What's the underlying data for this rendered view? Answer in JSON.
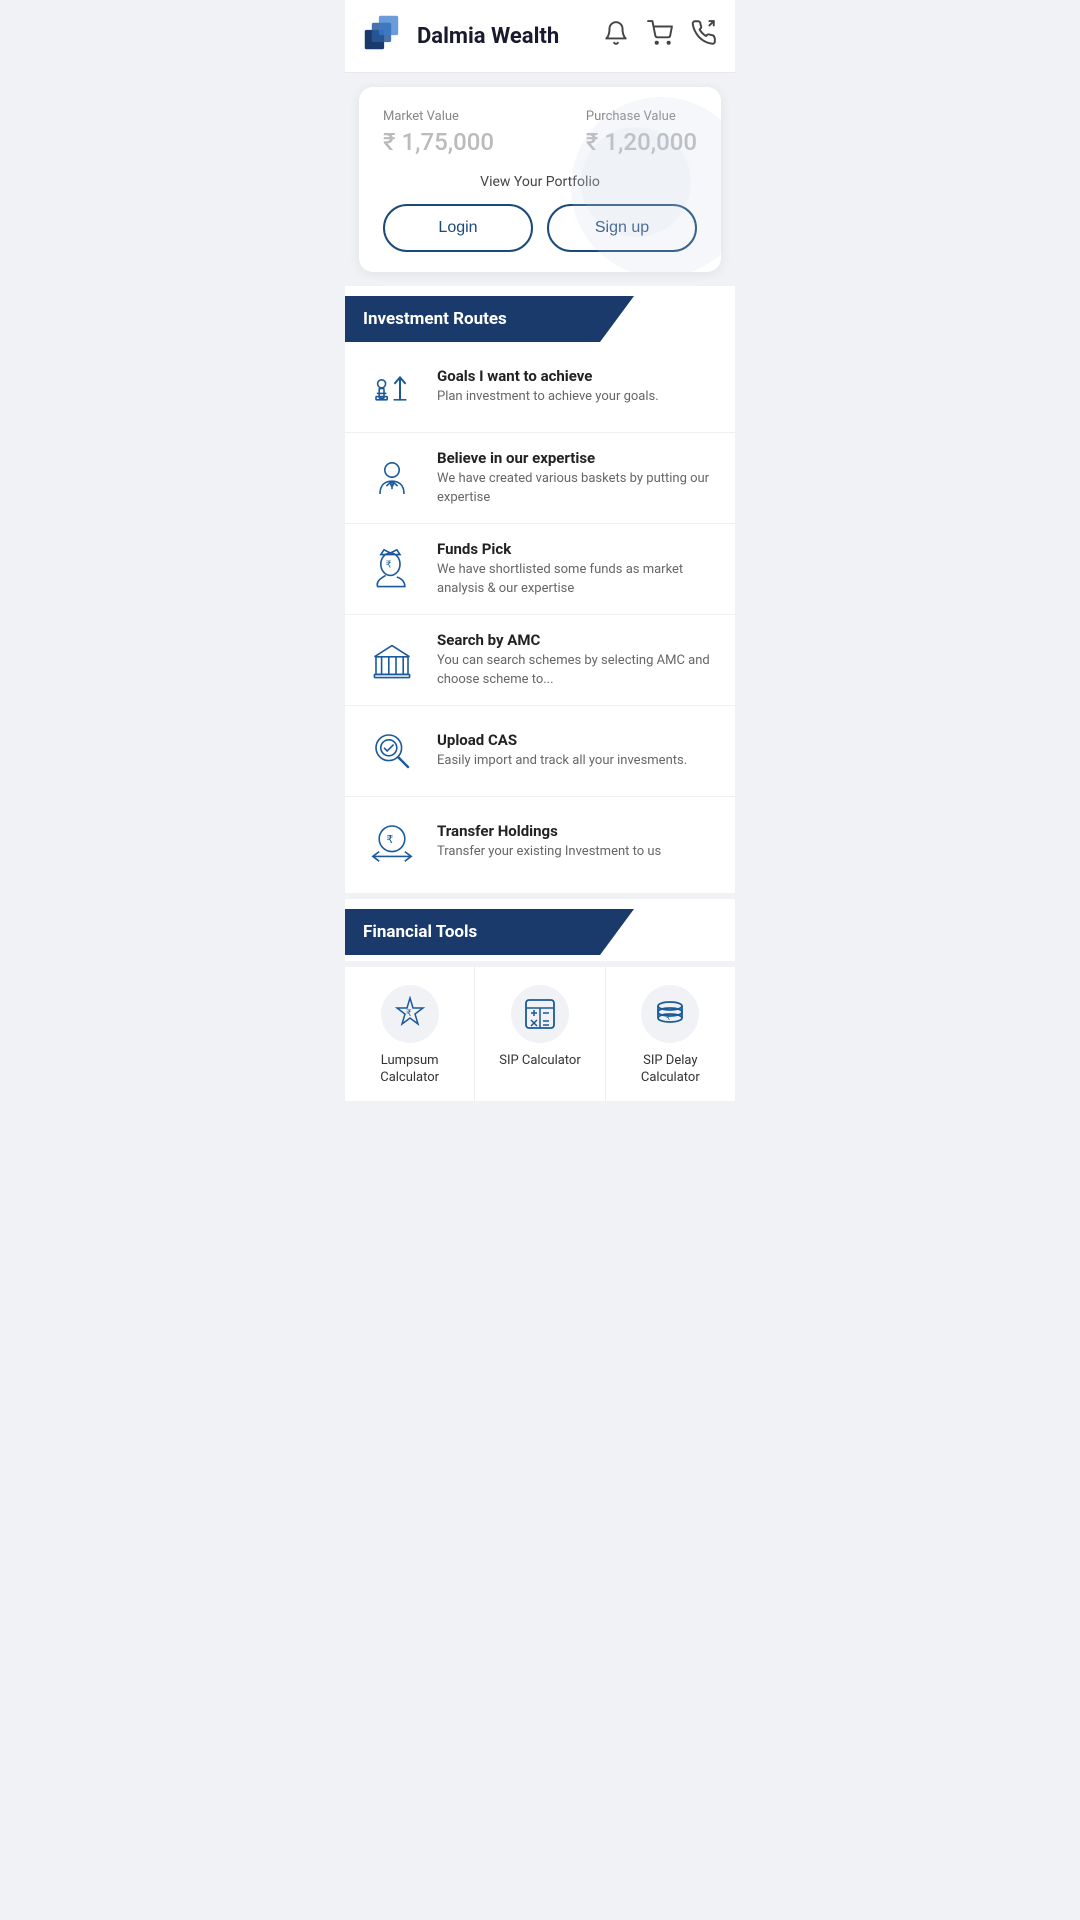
{
  "header": {
    "brand_name": "Dalmia Wealth",
    "icons": [
      "bell",
      "cart",
      "phone-chat"
    ]
  },
  "portfolio": {
    "market_value_label": "Market Value",
    "market_value": "₹ 1,75,000",
    "purchase_value_label": "Purchase Value",
    "purchase_value": "₹ 1,20,000",
    "subtitle": "View Your Portfolio",
    "login_label": "Login",
    "signup_label": "Sign up"
  },
  "investment_routes": {
    "section_title": "Investment Routes",
    "items": [
      {
        "title": "Goals I want to achieve",
        "desc": "Plan investment to achieve your goals.",
        "icon": "goals"
      },
      {
        "title": "Believe in our expertise",
        "desc": "We have created various baskets by putting our expertise",
        "icon": "expertise"
      },
      {
        "title": "Funds Pick",
        "desc": "We have shortlisted some funds as market analysis & our expertise",
        "icon": "funds-pick"
      },
      {
        "title": "Search by AMC",
        "desc": "You can search schemes by selecting AMC and choose scheme to...",
        "icon": "amc"
      },
      {
        "title": "Upload CAS",
        "desc": "Easily import and track all your invesments.",
        "icon": "upload-cas"
      },
      {
        "title": "Transfer Holdings",
        "desc": "Transfer your existing Investment to us",
        "icon": "transfer"
      }
    ]
  },
  "financial_tools": {
    "section_title": "Financial Tools",
    "items": [
      {
        "label": "Lumpsum\nCalculator",
        "icon": "lumpsum"
      },
      {
        "label": "SIP Calculator",
        "icon": "sip"
      },
      {
        "label": "SIP Delay\nCalculator",
        "icon": "sip-delay"
      }
    ]
  }
}
